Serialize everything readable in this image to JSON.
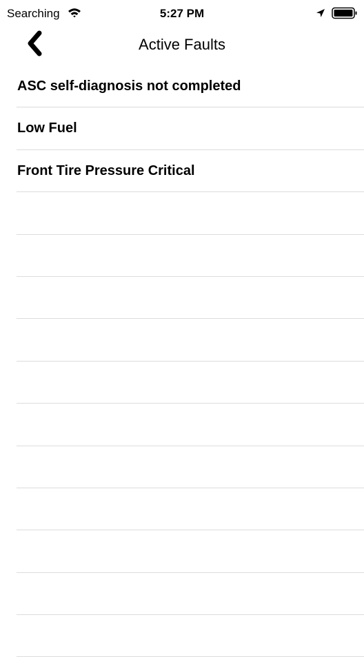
{
  "status_bar": {
    "carrier": "Searching",
    "time": "5:27 PM",
    "wifi_icon": "wifi-icon",
    "location_icon": "location-arrow-icon",
    "battery_icon": "battery-icon"
  },
  "nav": {
    "back_icon": "chevron-left-icon",
    "title": "Active Faults"
  },
  "faults": [
    "ASC self-diagnosis not completed",
    "Low Fuel",
    "Front Tire Pressure Critical",
    "",
    "",
    "",
    "",
    "",
    "",
    "",
    "",
    "",
    "",
    ""
  ],
  "colors": {
    "separator": "#dcdcdc",
    "text": "#000000",
    "background": "#ffffff"
  }
}
